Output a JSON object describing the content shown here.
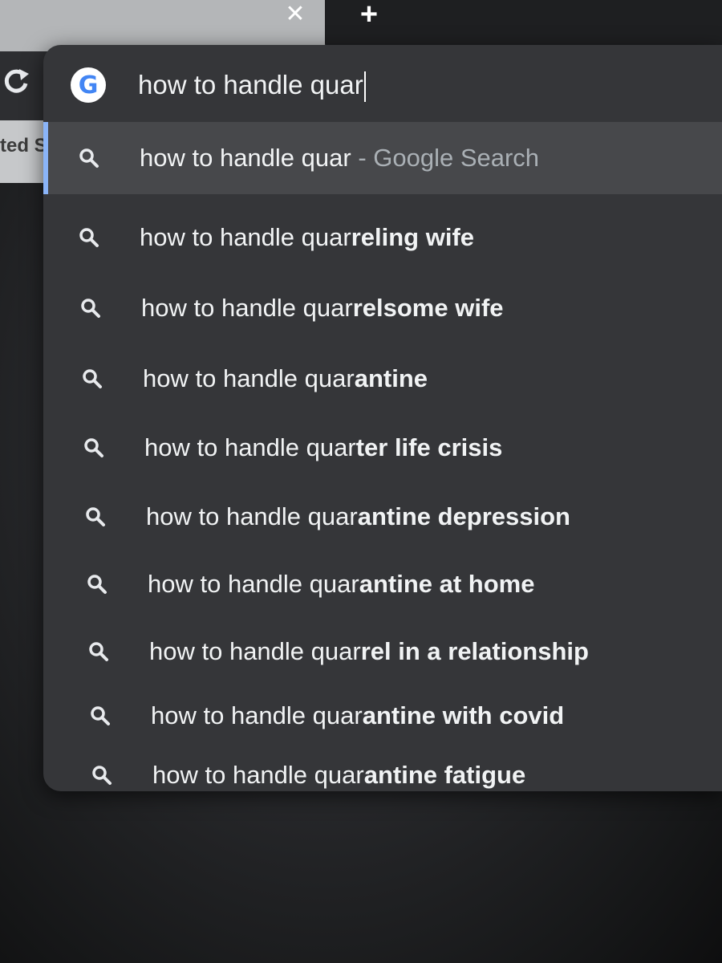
{
  "tabstrip": {
    "close_glyph": "✕",
    "new_tab_glyph": "+"
  },
  "toolbar": {
    "reload_glyph": "C",
    "bookmark_fragment": "ted S"
  },
  "omnibox": {
    "search_engine_icon": "google-g-icon",
    "search_engine_letter": "G",
    "query": "how to handle quar"
  },
  "suggestions": [
    {
      "prefix": "how to handle quar",
      "completion": "",
      "suffix": " - Google Search",
      "selected": true
    },
    {
      "prefix": "how to handle quar",
      "completion": "reling wife",
      "suffix": "",
      "selected": false
    },
    {
      "prefix": "how to handle quar",
      "completion": "relsome wife",
      "suffix": "",
      "selected": false
    },
    {
      "prefix": "how to handle quar",
      "completion": "antine",
      "suffix": "",
      "selected": false
    },
    {
      "prefix": "how to handle quar",
      "completion": "ter life crisis",
      "suffix": "",
      "selected": false
    },
    {
      "prefix": "how to handle quar",
      "completion": "antine depression",
      "suffix": "",
      "selected": false
    },
    {
      "prefix": "how to handle quar",
      "completion": "antine at home",
      "suffix": "",
      "selected": false
    },
    {
      "prefix": "how to handle quar",
      "completion": "rel in a relationship",
      "suffix": "",
      "selected": false
    },
    {
      "prefix": "how to handle quar",
      "completion": "antine with covid",
      "suffix": "",
      "selected": false
    },
    {
      "prefix": "how to handle quar",
      "completion": "antine fatigue",
      "suffix": "",
      "selected": false
    }
  ],
  "colors": {
    "dropdown_bg": "#353639",
    "selected_row_bg": "#47484b",
    "selection_accent": "#8ab4f8",
    "text": "#f1f3f4",
    "suffix_text": "#aab0b5"
  }
}
